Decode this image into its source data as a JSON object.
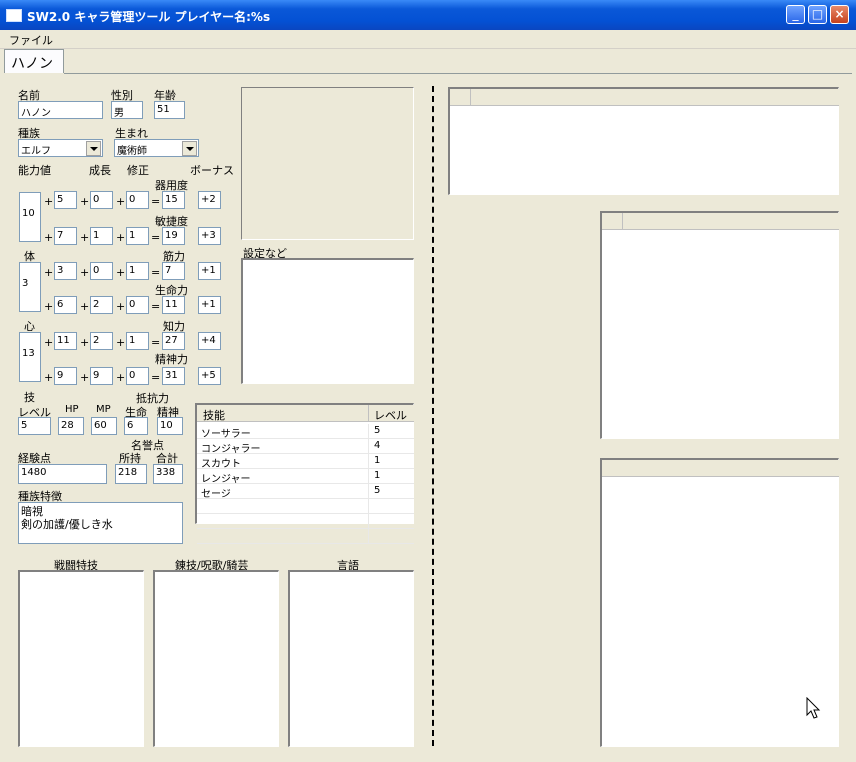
{
  "window": {
    "title": "SW2.0 キャラ管理ツール プレイヤー名:%s"
  },
  "menu": {
    "file": "ファイル"
  },
  "tab": {
    "label": "ハノン"
  },
  "labels": {
    "name": "名前",
    "gender": "性別",
    "age": "年齢",
    "race": "種族",
    "birth": "生まれ",
    "ability": "能力値",
    "growth": "成長",
    "modifier": "修正",
    "bonus": "ボーナス",
    "gi": "技",
    "tai": "体",
    "kokoro": "心",
    "dex": "器用度",
    "agi": "敏捷度",
    "str": "筋力",
    "vit": "生命力",
    "int": "知力",
    "spi": "精神力",
    "level": "レベル",
    "hp": "HP",
    "mp": "MP",
    "resist": "抵抗力",
    "life": "生命",
    "mental": "精神",
    "exp": "経験点",
    "honor": "名誉点",
    "owned": "所持",
    "total": "合計",
    "race_trait": "種族特徴",
    "settings": "設定など",
    "combat": "戦闘特技",
    "arts": "錬技/呪歌/騎芸",
    "language": "言語",
    "skill_col": "技能",
    "level_col": "レベル"
  },
  "character": {
    "name": "ハノン",
    "gender": "男",
    "age": "51",
    "race": "エルフ",
    "birth": "魔術師",
    "gi_base": "10",
    "tai_base": "3",
    "kokoro_base": "13",
    "dex": {
      "a": "5",
      "g": "0",
      "m": "0",
      "v": "15",
      "b": "+2"
    },
    "agi": {
      "a": "7",
      "g": "1",
      "m": "1",
      "v": "19",
      "b": "+3"
    },
    "str": {
      "a": "3",
      "g": "0",
      "m": "1",
      "v": "7",
      "b": "+1"
    },
    "vit": {
      "a": "6",
      "g": "2",
      "m": "0",
      "v": "11",
      "b": "+1"
    },
    "int": {
      "a": "11",
      "g": "2",
      "m": "1",
      "v": "27",
      "b": "+4"
    },
    "spi": {
      "a": "9",
      "g": "9",
      "m": "0",
      "v": "31",
      "b": "+5"
    },
    "level": "5",
    "hp": "28",
    "mp": "60",
    "res_life": "6",
    "res_mental": "10",
    "exp": "1480",
    "honor_owned": "218",
    "honor_total": "338",
    "trait_line1": "暗視",
    "trait_line2": "剣の加護/優しき水"
  },
  "skills": [
    {
      "name": "ソーサラー",
      "level": "5"
    },
    {
      "name": "コンジャラー",
      "level": "4"
    },
    {
      "name": "スカウト",
      "level": "1"
    },
    {
      "name": "レンジャー",
      "level": "1"
    },
    {
      "name": "セージ",
      "level": "5"
    }
  ]
}
